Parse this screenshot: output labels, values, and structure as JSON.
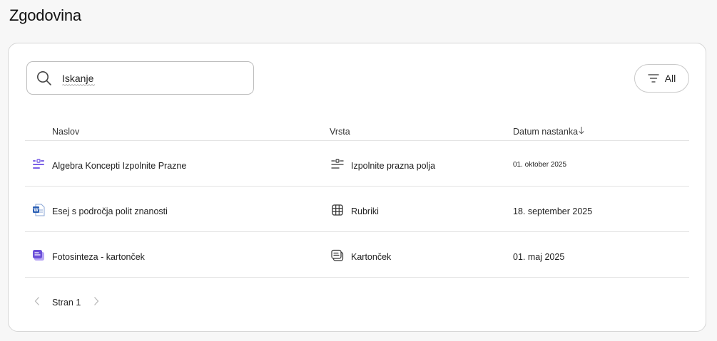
{
  "page": {
    "title": "Zgodovina"
  },
  "search": {
    "value": "Iskanje"
  },
  "filter": {
    "label": "All"
  },
  "columns": {
    "title": "Naslov",
    "type": "Vrsta",
    "date": "Datum nastanka"
  },
  "rows": [
    {
      "title": "Algebra Koncepti Izpolnite Prazne",
      "type": "Izpolnite prazna polja",
      "date": "01. oktober 2025"
    },
    {
      "title": "Esej s področja polit znanosti",
      "type": "Rubriki",
      "date": "18. september 2025"
    },
    {
      "title": "Fotosinteza - kartonček",
      "type": "Kartonček",
      "date": "01. maj 2025"
    }
  ],
  "pager": {
    "label": "Stran 1"
  },
  "colors": {
    "accent_purple": "#6b4fd8",
    "word_blue": "#2b5fb4"
  }
}
